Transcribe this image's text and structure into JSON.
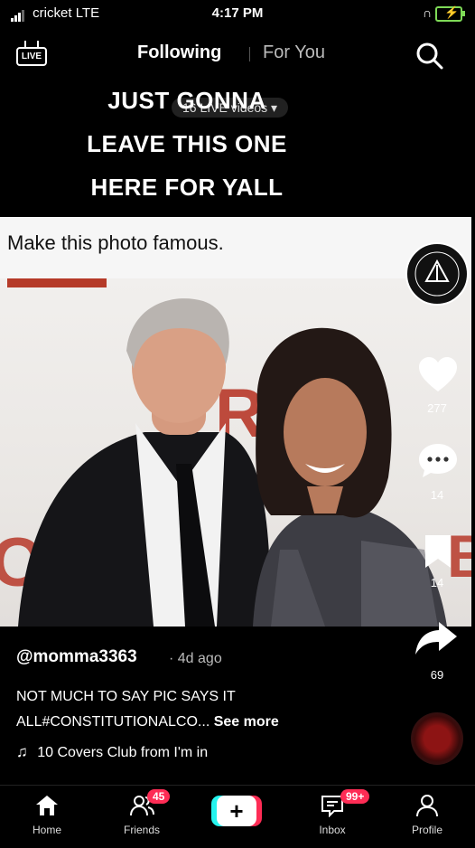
{
  "status_bar": {
    "carrier": "cricket",
    "network": "LTE",
    "time": "4:17 PM"
  },
  "top_nav": {
    "live_label": "LIVE",
    "tabs": [
      {
        "label": "Following",
        "active": true
      },
      {
        "label": "For You",
        "active": false
      }
    ]
  },
  "overlay": {
    "lines": [
      "JUST GONNA",
      "LEAVE THIS ONE",
      "HERE FOR YALL"
    ],
    "live_videos_pill": "16 LIVE videos ▾"
  },
  "banner": {
    "text": "Make this photo famous."
  },
  "actions": {
    "likes": "277",
    "comments": "14",
    "saves": "14",
    "shares": "69"
  },
  "post": {
    "handle": "@momma3363",
    "posted": "· 4d ago",
    "caption_line1": "NOT MUCH TO SAY PIC SAYS IT",
    "caption_line2": "ALL#CONSTITUTIONALCO...",
    "see_more": "See more",
    "music": "10 Covers Club from I'm in"
  },
  "bottom_nav": {
    "home": "Home",
    "friends": "Friends",
    "friends_badge": "45",
    "inbox": "Inbox",
    "inbox_badge": "99+",
    "profile": "Profile"
  },
  "colors": {
    "accent_red": "#fe2c55",
    "accent_cyan": "#25f4ee",
    "battery_green": "#7ed957"
  }
}
